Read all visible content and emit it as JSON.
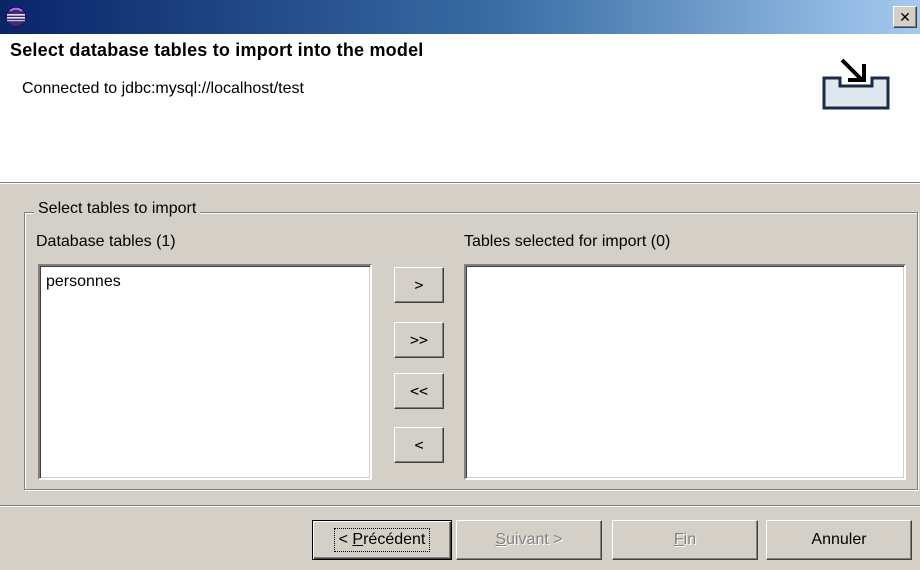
{
  "window": {
    "icon": "eclipse-icon",
    "close_icon": "close-icon",
    "close_glyph": "✕"
  },
  "header": {
    "title": "Select database tables to import into the model",
    "subtitle": "Connected to jdbc:mysql://localhost/test",
    "icon": "import-wizard-icon"
  },
  "group": {
    "legend": "Select tables to import",
    "left_label": "Database tables (1)",
    "right_label": "Tables selected for import (0)",
    "left_items": [
      "personnes"
    ],
    "right_items": []
  },
  "move_buttons": {
    "add": ">",
    "add_all": ">>",
    "remove_all": "<<",
    "remove": "<"
  },
  "footer": {
    "prev_prefix": "< ",
    "prev_mnemonic": "P",
    "prev_rest": "récédent",
    "next_mnemonic": "S",
    "next_rest": "uivant >",
    "finish_mnemonic": "F",
    "finish_rest": "in",
    "cancel": "Annuler"
  }
}
